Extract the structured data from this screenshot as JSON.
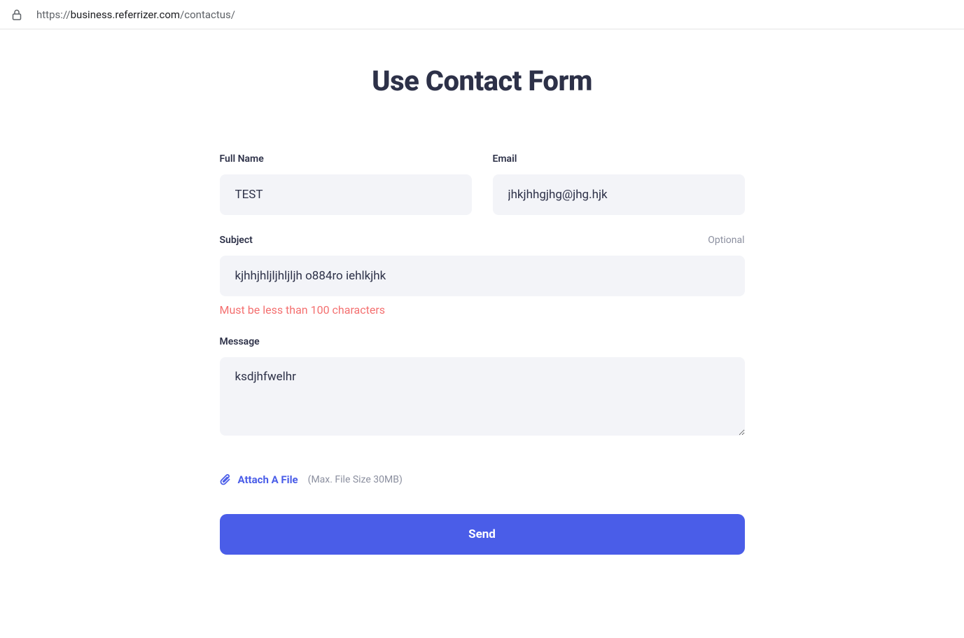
{
  "address_bar": {
    "protocol": "https://",
    "domain": "business.referrizer.com",
    "path": "/contactus/"
  },
  "page": {
    "title": "Use Contact Form"
  },
  "form": {
    "full_name": {
      "label": "Full Name",
      "value": "TEST"
    },
    "email": {
      "label": "Email",
      "value": "jhkjhhgjhg@jhg.hjk"
    },
    "subject": {
      "label": "Subject",
      "optional_text": "Optional",
      "value": "kjhhjhljljhljljh o884ro iehlkjhk",
      "error": "Must be less than 100 characters"
    },
    "message": {
      "label": "Message",
      "value": "ksdjhfwelhr"
    },
    "attach": {
      "label": "Attach A File",
      "hint": "(Max. File Size 30MB)"
    },
    "submit": {
      "label": "Send"
    }
  }
}
